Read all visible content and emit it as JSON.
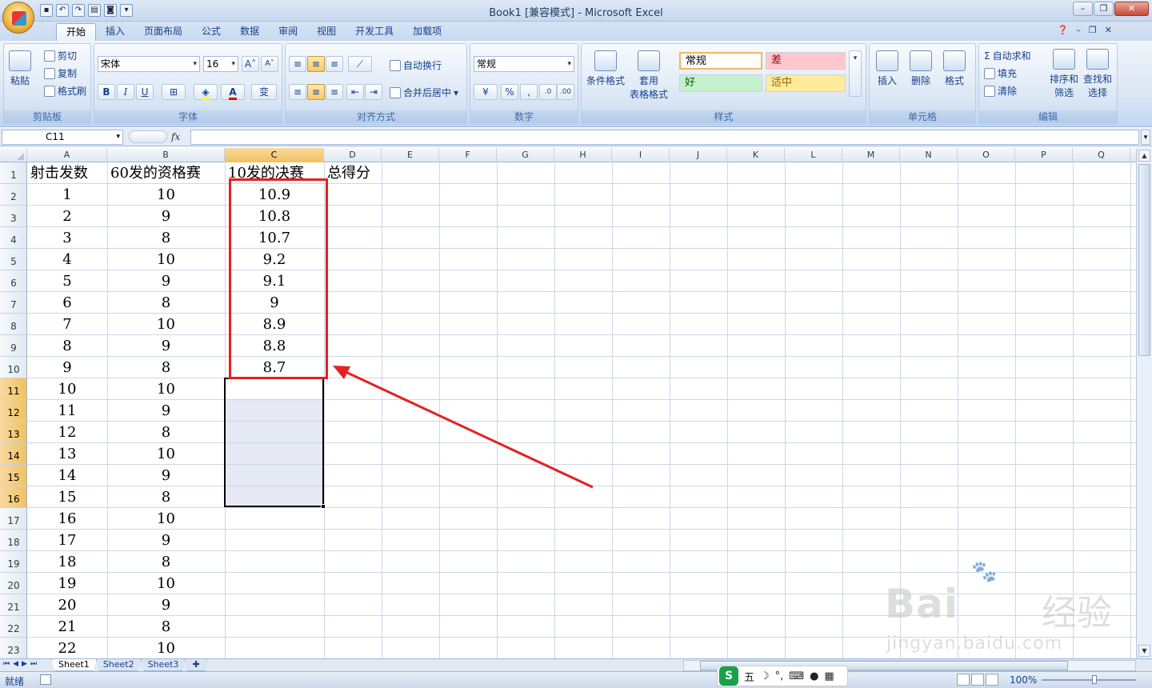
{
  "window": {
    "title": "Book1 [兼容模式] - Microsoft Excel",
    "controls": [
      "–",
      "❐",
      "✕"
    ]
  },
  "tabs": [
    "开始",
    "插入",
    "页面布局",
    "公式",
    "数据",
    "审阅",
    "视图",
    "开发工具",
    "加载项"
  ],
  "active_tab": "开始",
  "ribbon": {
    "clipboard": {
      "paste": "粘贴",
      "cut": "剪切",
      "copy": "复制",
      "format_painter": "格式刷",
      "label": "剪贴板"
    },
    "font": {
      "name": "宋体",
      "size": "16",
      "bold": "B",
      "italic": "I",
      "underline": "U",
      "grow": "A",
      "shrink": "A",
      "color_letter": "A",
      "phonetic": "变",
      "label": "字体"
    },
    "alignment": {
      "wrap": "自动换行",
      "merge": "合并后居中",
      "label": "对齐方式"
    },
    "number": {
      "format": "常规",
      "percent": "%",
      "comma": ",",
      "label": "数字"
    },
    "styles": {
      "conditional": "条件格式",
      "table_fmt_1": "套用",
      "table_fmt_2": "表格格式",
      "normal": "常规",
      "bad": "差",
      "good": "好",
      "neutral": "适中",
      "label": "样式"
    },
    "cells": {
      "insert": "插入",
      "delete": "删除",
      "format": "格式",
      "label": "单元格"
    },
    "editing": {
      "autosum": "自动求和",
      "fill": "填充",
      "clear": "清除",
      "sort_1": "排序和",
      "sort_2": "筛选",
      "find_1": "查找和",
      "find_2": "选择",
      "label": "编辑"
    }
  },
  "formula_bar": {
    "name_box": "C11",
    "fx": "fx",
    "value": ""
  },
  "columns": [
    "A",
    "B",
    "C",
    "D",
    "E",
    "F",
    "G",
    "H",
    "I",
    "J",
    "K",
    "L",
    "M",
    "N",
    "O",
    "P",
    "Q"
  ],
  "rows": [
    "1",
    "2",
    "3",
    "4",
    "5",
    "6",
    "7",
    "8",
    "9",
    "10",
    "11",
    "12",
    "13",
    "14",
    "15",
    "16",
    "17",
    "18",
    "19",
    "20",
    "21",
    "22",
    "23"
  ],
  "sheet": {
    "headers": [
      "射击发数",
      "60发的资格赛",
      "10发的决赛",
      "总得分"
    ],
    "col_a": [
      "1",
      "2",
      "3",
      "4",
      "5",
      "6",
      "7",
      "8",
      "9",
      "10",
      "11",
      "12",
      "13",
      "14",
      "15",
      "16",
      "17",
      "18",
      "19",
      "20",
      "21",
      "22"
    ],
    "col_b": [
      "10",
      "9",
      "8",
      "10",
      "9",
      "8",
      "10",
      "9",
      "8",
      "10",
      "9",
      "8",
      "10",
      "9",
      "8",
      "10",
      "9",
      "8",
      "10",
      "9",
      "8",
      "10"
    ],
    "col_c": [
      "10.9",
      "10.8",
      "10.7",
      "9.2",
      "9.1",
      "9",
      "8.9",
      "8.8",
      "8.7"
    ]
  },
  "sheet_tabs": [
    "Sheet1",
    "Sheet2",
    "Sheet3"
  ],
  "active_sheet": "Sheet1",
  "status": {
    "ready": "就绪",
    "zoom": "100%"
  },
  "ime": {
    "logo": "S",
    "mode": "五"
  },
  "watermark": {
    "brand": "Bai",
    "brand_cn": "经验",
    "url": "jingyan.baidu.com"
  },
  "colors": {
    "annotation": "#e52020",
    "selected_header": "#f1c15f",
    "ribbon": "#d7e4f4"
  }
}
